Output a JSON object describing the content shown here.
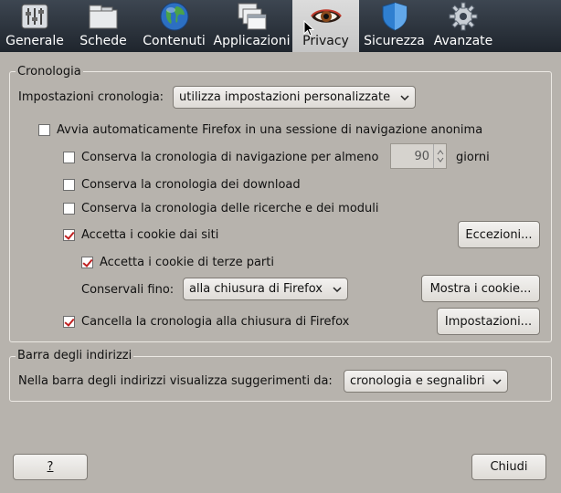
{
  "toolbar": {
    "tabs": [
      {
        "label": "Generale",
        "icon": "general-settings-icon"
      },
      {
        "label": "Schede",
        "icon": "tabs-icon"
      },
      {
        "label": "Contenuti",
        "icon": "globe-icon"
      },
      {
        "label": "Applicazioni",
        "icon": "applications-icon"
      },
      {
        "label": "Privacy",
        "icon": "eye-mask-icon",
        "active": true
      },
      {
        "label": "Sicurezza",
        "icon": "shield-icon"
      },
      {
        "label": "Avanzate",
        "icon": "gear-icon"
      }
    ]
  },
  "history": {
    "title": "Cronologia",
    "settings_label": "Impostazioni cronologia:",
    "settings_value": "utilizza impostazioni personalizzate",
    "private_mode_label": "Avvia automaticamente Firefox in una sessione di navigazione anonima",
    "private_mode_checked": false,
    "browsing_label": "Conserva la cronologia di navigazione per almeno",
    "browsing_checked": false,
    "browsing_days": "90",
    "browsing_days_unit": "giorni",
    "downloads_label": "Conserva la cronologia dei download",
    "downloads_checked": false,
    "forms_label": "Conserva la cronologia delle ricerche e dei moduli",
    "forms_checked": false,
    "cookies_label": "Accetta i cookie dai siti",
    "cookies_checked": true,
    "exceptions_button": "Eccezioni...",
    "third_party_label": "Accetta i cookie di terze parti",
    "third_party_checked": true,
    "keep_until_label": "Conservali fino:",
    "keep_until_value": "alla chiusura di Firefox",
    "show_cookies_button": "Mostra i cookie...",
    "clear_on_close_label": "Cancella la cronologia alla chiusura di Firefox",
    "clear_on_close_checked": true,
    "settings_button": "Impostazioni..."
  },
  "location_bar": {
    "title": "Barra degli indirizzi",
    "suggest_label": "Nella barra degli indirizzi visualizza suggerimenti da:",
    "suggest_value": "cronologia e segnalibri"
  },
  "footer": {
    "help_button": "?",
    "close_button": "Chiudi"
  },
  "colors": {
    "background": "#b7b3ad",
    "toolbar": "#2a3038",
    "checkmark": "#c02020"
  }
}
